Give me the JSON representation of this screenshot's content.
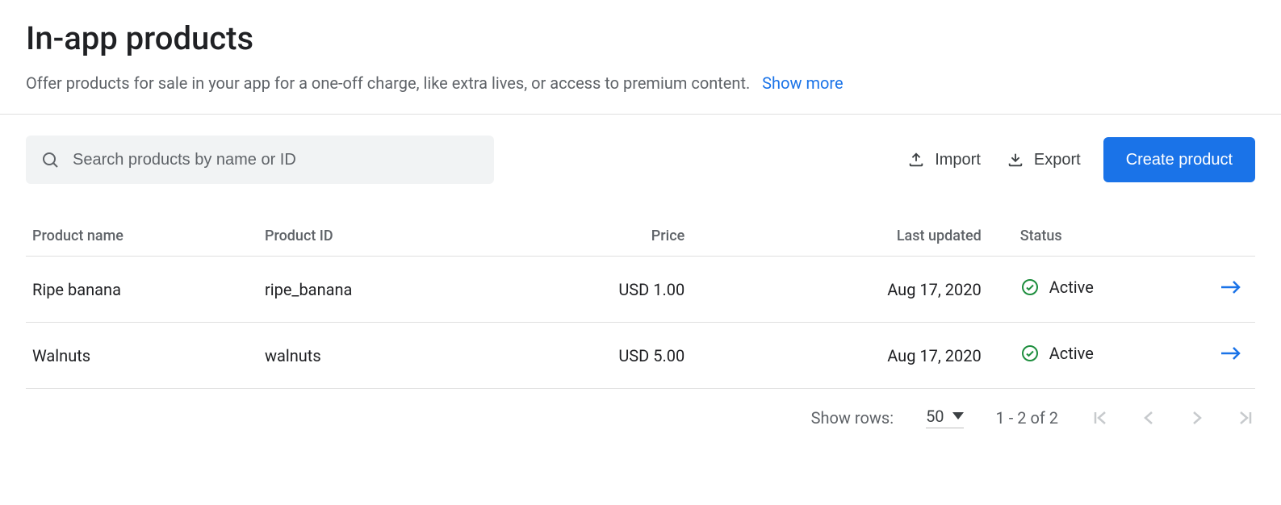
{
  "header": {
    "title": "In-app products",
    "subtitle": "Offer products for sale in your app for a one-off charge, like extra lives, or access to premium content.",
    "show_more": "Show more"
  },
  "toolbar": {
    "search_placeholder": "Search products by name or ID",
    "import_label": "Import",
    "export_label": "Export",
    "create_label": "Create product"
  },
  "table": {
    "columns": {
      "name": "Product name",
      "id": "Product ID",
      "price": "Price",
      "updated": "Last updated",
      "status": "Status"
    },
    "rows": [
      {
        "name": "Ripe banana",
        "id": "ripe_banana",
        "price": "USD 1.00",
        "updated": "Aug 17, 2020",
        "status": "Active"
      },
      {
        "name": "Walnuts",
        "id": "walnuts",
        "price": "USD 5.00",
        "updated": "Aug 17, 2020",
        "status": "Active"
      }
    ]
  },
  "pagination": {
    "show_rows_label": "Show rows:",
    "rows_per_page": "50",
    "range": "1 - 2 of 2"
  },
  "colors": {
    "link": "#1a73e8",
    "status_ok": "#1e8e3e"
  }
}
